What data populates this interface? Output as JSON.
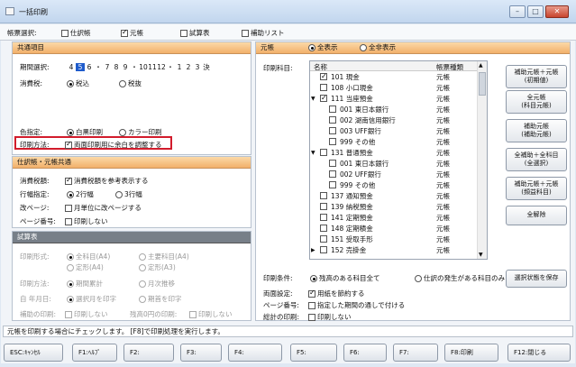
{
  "window": {
    "title": "一括印刷",
    "min": "–",
    "max": "□",
    "close": "✕"
  },
  "topbar": {
    "label": "帳票選択:",
    "opts": [
      "仕訳帳",
      "元帳",
      "試算表",
      "補助リスト"
    ]
  },
  "common": {
    "title": "共通項目",
    "period_label": "期間選択:",
    "months": [
      "4",
      "5",
      "6",
      "・",
      "7",
      "8",
      "9",
      "・",
      "10",
      "11",
      "12",
      "・",
      "1",
      "2",
      "3",
      "決"
    ],
    "tax_label": "消費税:",
    "tax_opts": [
      "税込",
      "税抜"
    ],
    "color_label": "色指定:",
    "color_opts": [
      "白黒印刷",
      "カラー印刷"
    ],
    "method_label": "印刷方法:",
    "method_check": "両面印刷用に余白を調整する"
  },
  "journal": {
    "title": "仕訳帳・元帳共通",
    "tax_amt_label": "消費税額:",
    "tax_amt_check": "消費税額を参考表示する",
    "lines_label": "行幅指定:",
    "lines_opts": [
      "2行幅",
      "3行幅"
    ],
    "pagebreak_label": "改ページ:",
    "pagebreak_check": "月単位に改ページする",
    "pageno_label": "ページ番号:",
    "pageno_check": "印刷しない"
  },
  "trial": {
    "title": "試算表",
    "form_label": "印刷形式:",
    "form_opts": [
      "全科目(A4)",
      "主要科目(A4)",
      "定形(A4)",
      "定形(A3)"
    ],
    "method_label": "印刷方法:",
    "method_opts": [
      "期間累計",
      "月次推移"
    ],
    "month_label": "自 年月日:",
    "month_opts": [
      "選択月を印字",
      "期首を印字"
    ],
    "aux_label": "補助の印刷:",
    "aux_check": "印刷しない",
    "zero_label": "残高0円の印刷:",
    "zero_check": "印刷しない"
  },
  "ledger": {
    "title": "元帳",
    "view_opts": [
      "全表示",
      "全非表示"
    ],
    "items_label": "印刷科目:",
    "col_name": "名称",
    "col_type": "帳票種類",
    "rows": [
      {
        "name": "101 現金",
        "type": "元帳",
        "level": 0,
        "checked": true,
        "arrow": ""
      },
      {
        "name": "108 小口現金",
        "type": "元帳",
        "level": 0,
        "checked": false,
        "arrow": ""
      },
      {
        "name": "111 当座預金",
        "type": "元帳",
        "level": 0,
        "checked": true,
        "arrow": "▼"
      },
      {
        "name": "001 東日本銀行",
        "type": "元帳",
        "level": 1,
        "checked": false,
        "arrow": ""
      },
      {
        "name": "002 湖南信用銀行",
        "type": "元帳",
        "level": 1,
        "checked": false,
        "arrow": ""
      },
      {
        "name": "003 UFF銀行",
        "type": "元帳",
        "level": 1,
        "checked": false,
        "arrow": ""
      },
      {
        "name": "999 その他",
        "type": "元帳",
        "level": 1,
        "checked": false,
        "arrow": ""
      },
      {
        "name": "131 普通預金",
        "type": "元帳",
        "level": 0,
        "checked": false,
        "arrow": "▼"
      },
      {
        "name": "001 東日本銀行",
        "type": "元帳",
        "level": 1,
        "checked": false,
        "arrow": ""
      },
      {
        "name": "002 UFF銀行",
        "type": "元帳",
        "level": 1,
        "checked": false,
        "arrow": ""
      },
      {
        "name": "999 その他",
        "type": "元帳",
        "level": 1,
        "checked": false,
        "arrow": ""
      },
      {
        "name": "137 通知預金",
        "type": "元帳",
        "level": 0,
        "checked": false,
        "arrow": ""
      },
      {
        "name": "139 納税預金",
        "type": "元帳",
        "level": 0,
        "checked": false,
        "arrow": ""
      },
      {
        "name": "141 定期預金",
        "type": "元帳",
        "level": 0,
        "checked": false,
        "arrow": ""
      },
      {
        "name": "148 定期積金",
        "type": "元帳",
        "level": 0,
        "checked": false,
        "arrow": ""
      },
      {
        "name": "151 受取手形",
        "type": "元帳",
        "level": 0,
        "checked": false,
        "arrow": ""
      },
      {
        "name": "152 売掛金",
        "type": "元帳",
        "level": 0,
        "checked": false,
        "arrow": "▶"
      }
    ],
    "buttons": [
      "補助元帳＋元帳|(初期値)",
      "全元帳|(科目元帳)",
      "補助元帳|(補助元帳)",
      "全補助＋全科目|(全選択)",
      "補助元帳＋元帳|(頻益科目)",
      "全解除",
      "選択状態を保存"
    ],
    "cond_label": "印刷条件:",
    "cond_opts": [
      "残高のある科目全て",
      "仕訳の発生がある科目のみ"
    ],
    "duplex_label": "両面設定:",
    "duplex_check": "用紙を節約する",
    "page_label": "ページ番号:",
    "page_check": "指定した期間の通しで付ける",
    "total_label": "総計の印刷:",
    "total_check": "印刷しない"
  },
  "status": "元帳を印刷する場合にチェックします。 [F8]で印刷処理を実行します。",
  "fkeys": [
    "ESC:ｷｬﾝｾﾙ",
    "F1:ﾍﾙﾌﾟ",
    "F2:",
    "F3:",
    "F4:",
    "F5:",
    "F6:",
    "F7:",
    "F8:印刷",
    "F12:閉じる"
  ]
}
